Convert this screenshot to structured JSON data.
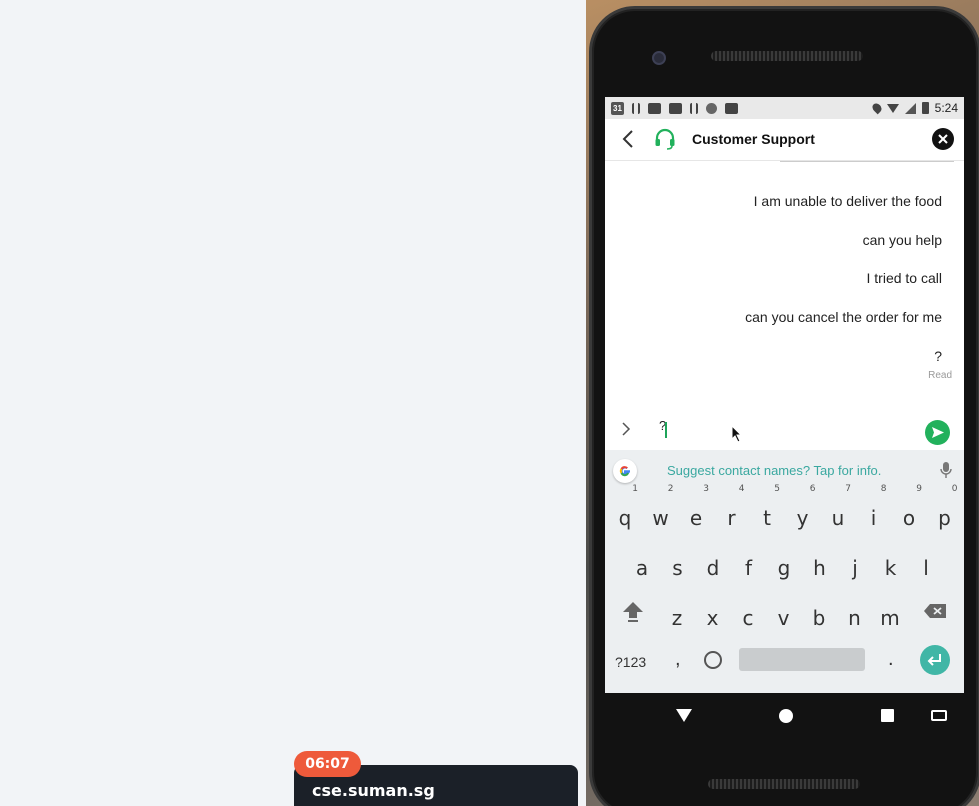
{
  "presenter": {
    "timer": "06:07",
    "name": "cse.suman.sg"
  },
  "status_bar": {
    "calendar_day": "31",
    "time": "5:24"
  },
  "header": {
    "title": "Customer Support"
  },
  "messages": [
    "I am unable to deliver the food",
    "can you help",
    "I tried to call",
    "can you cancel the order for me",
    "?"
  ],
  "read_receipt": "Read",
  "input": {
    "value": "?"
  },
  "keyboard": {
    "suggestion": "Suggest contact names? Tap for info.",
    "row1": [
      {
        "k": "q",
        "n": "1"
      },
      {
        "k": "w",
        "n": "2"
      },
      {
        "k": "e",
        "n": "3"
      },
      {
        "k": "r",
        "n": "4"
      },
      {
        "k": "t",
        "n": "5"
      },
      {
        "k": "y",
        "n": "6"
      },
      {
        "k": "u",
        "n": "7"
      },
      {
        "k": "i",
        "n": "8"
      },
      {
        "k": "o",
        "n": "9"
      },
      {
        "k": "p",
        "n": "0"
      }
    ],
    "row2": [
      "a",
      "s",
      "d",
      "f",
      "g",
      "h",
      "j",
      "k",
      "l"
    ],
    "row3": [
      "z",
      "x",
      "c",
      "v",
      "b",
      "n",
      "m"
    ],
    "symbols_label": "?123",
    "comma_label": ",",
    "period_label": "."
  },
  "colors": {
    "accent": "#22b15c",
    "timer_badge": "#ee5a3b",
    "suggest_text": "#3aa8a0",
    "enter_key": "#40b6a6"
  },
  "icons": [
    "back-icon",
    "headset-icon",
    "close-icon",
    "expand-icon",
    "send-icon",
    "google-icon",
    "mic-icon",
    "shift-icon",
    "backspace-icon",
    "emoji-icon",
    "enter-icon"
  ]
}
